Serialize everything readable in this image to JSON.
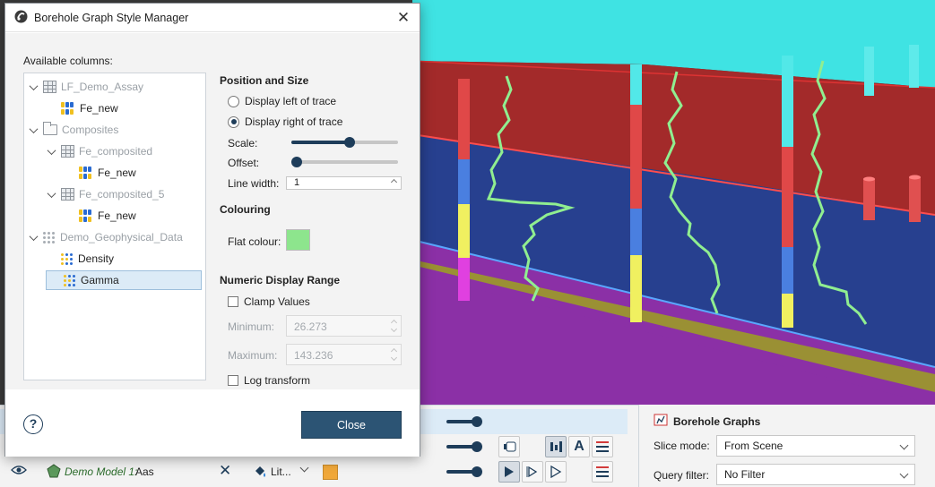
{
  "dialog": {
    "title": "Borehole Graph Style Manager",
    "available_columns_label": "Available columns:",
    "tree": [
      {
        "label": "LF_Demo_Assay",
        "kind": "table",
        "depth": 0,
        "expanded": true,
        "greyed": true
      },
      {
        "label": "Fe_new",
        "kind": "column",
        "depth": 1
      },
      {
        "label": "Composites",
        "kind": "folder",
        "depth": 0,
        "expanded": true,
        "greyed": true
      },
      {
        "label": "Fe_composited",
        "kind": "table",
        "depth": 1,
        "expanded": true,
        "greyed": true
      },
      {
        "label": "Fe_new",
        "kind": "column",
        "depth": 2
      },
      {
        "label": "Fe_composited_5",
        "kind": "table",
        "depth": 1,
        "expanded": true,
        "greyed": true
      },
      {
        "label": "Fe_new",
        "kind": "column",
        "depth": 2
      },
      {
        "label": "Demo_Geophysical_Data",
        "kind": "points",
        "depth": 0,
        "expanded": true,
        "greyed": true
      },
      {
        "label": "Density",
        "kind": "points-column",
        "depth": 1
      },
      {
        "label": "Gamma",
        "kind": "points-column",
        "depth": 1,
        "selected": true
      }
    ],
    "position_and_size": {
      "heading": "Position and Size",
      "display_left_label": "Display left of trace",
      "display_right_label": "Display right of trace",
      "selected": "right",
      "scale_label": "Scale:",
      "scale_value": 0.55,
      "offset_label": "Offset:",
      "offset_value": 0.0,
      "line_width_label": "Line width:",
      "line_width_value": "1"
    },
    "colouring": {
      "heading": "Colouring",
      "flat_colour_label": "Flat colour:",
      "flat_colour": "#8de58d"
    },
    "numeric_range": {
      "heading": "Numeric Display Range",
      "clamp_label": "Clamp Values",
      "clamp_checked": false,
      "minimum_label": "Minimum:",
      "minimum_value": "26.273",
      "maximum_label": "Maximum:",
      "maximum_value": "143.236",
      "log_label": "Log transform",
      "log_checked": false
    },
    "close_label": "Close",
    "help_symbol": "?"
  },
  "background": {
    "model_row": {
      "label_italic": "Demo Model 1:",
      "label_rest": " Aas",
      "lith_label": "Lit..."
    },
    "accent": "#1e3d5a"
  },
  "properties_panel": {
    "title": "Borehole Graphs",
    "slice_mode_label": "Slice mode:",
    "slice_mode_value": "From Scene",
    "query_filter_label": "Query filter:",
    "query_filter_value": "No Filter"
  },
  "colors": {
    "cyan_layer": "#3fe0e0",
    "red_layer": "#a42b2b",
    "blue_layer": "#273f8f",
    "purple_layer": "#8a2fa5",
    "olive_layer": "#9a9a2a",
    "graph_line": "#90ee90"
  }
}
